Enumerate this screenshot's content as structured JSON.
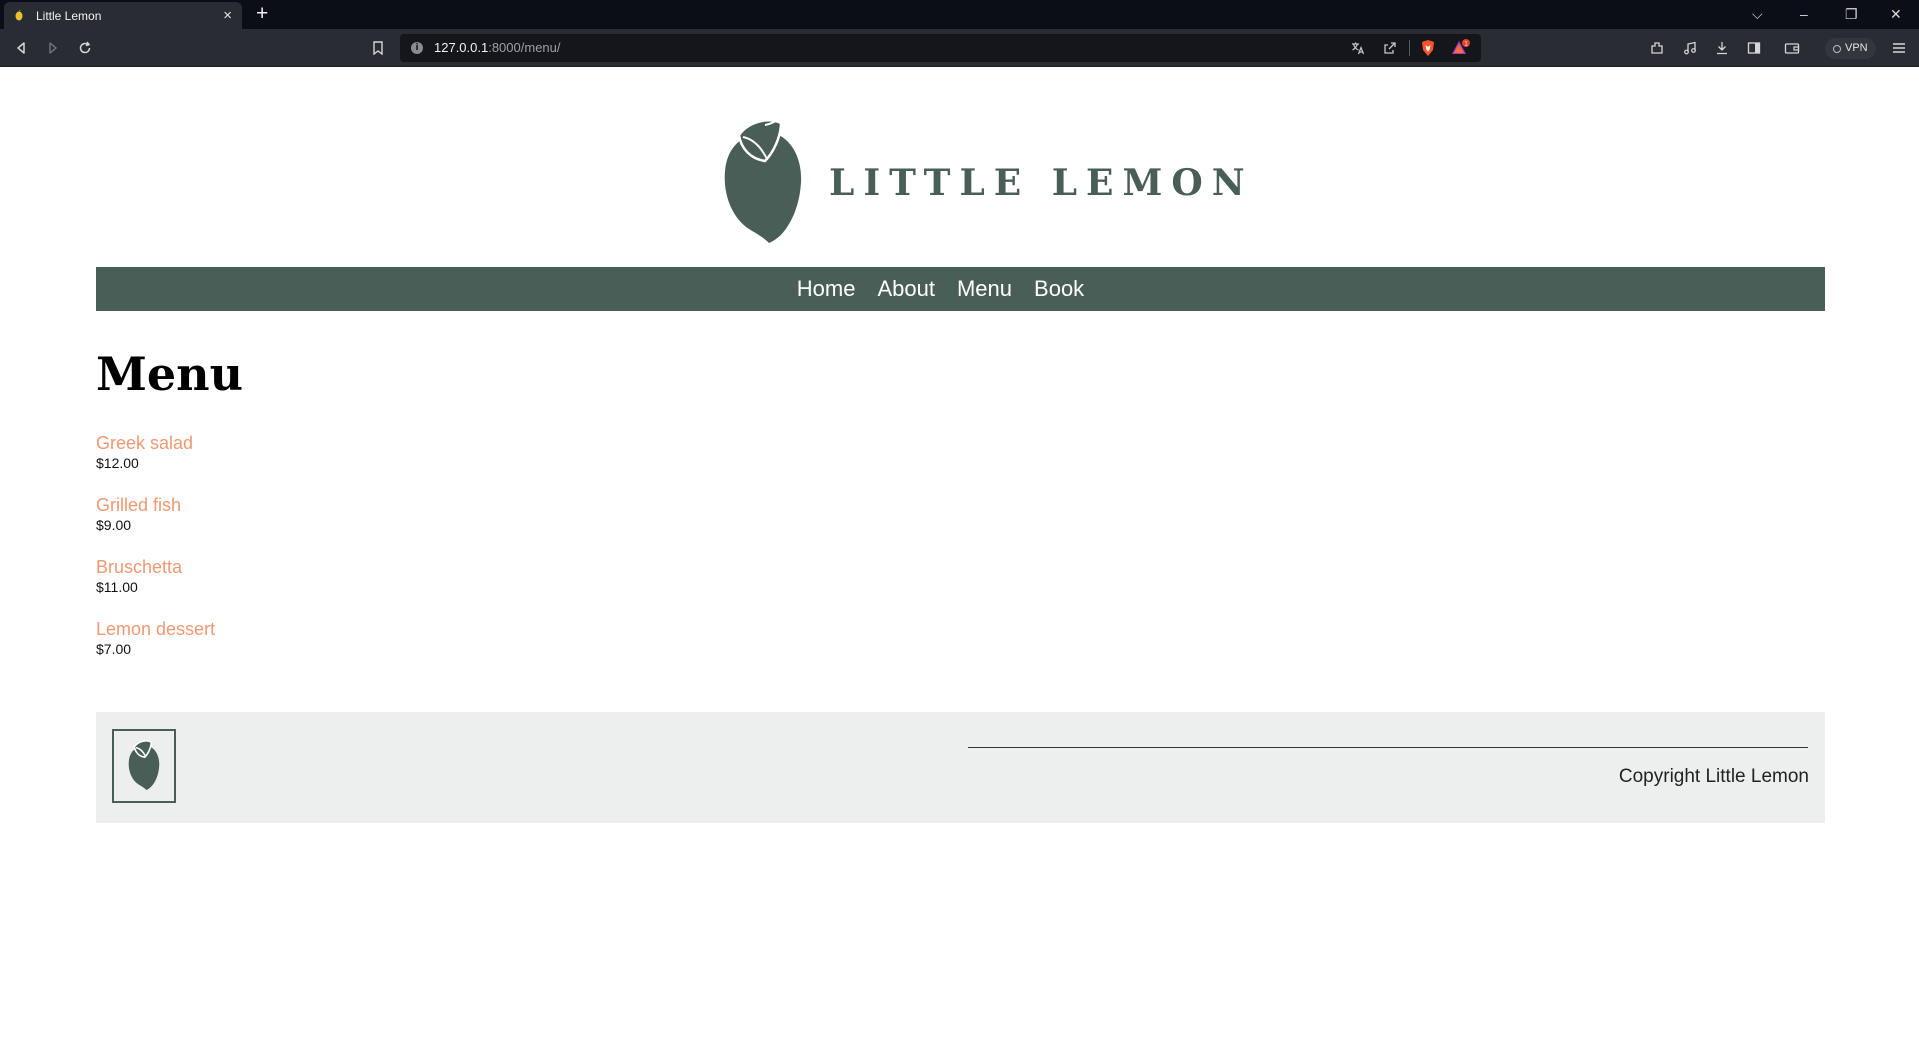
{
  "browser": {
    "tab_title": "Little Lemon",
    "tab_close": "×",
    "new_tab": "+",
    "url_host": "127.0.0.1",
    "url_rest": ":8000/menu/",
    "url_info": "i",
    "vpn_label": "VPN",
    "shield_badge_count": "1",
    "window_controls": {
      "tab_list": "⌵",
      "minimize": "–",
      "restore": "❐",
      "close": "✕"
    }
  },
  "site": {
    "brand": "LITTLE LEMON",
    "brand_color": "#495e57",
    "accent_color": "#ee9972",
    "nav": [
      "Home",
      "About",
      "Menu",
      "Book"
    ]
  },
  "main": {
    "title": "Menu",
    "items": [
      {
        "name": "Greek salad",
        "price": "$12.00"
      },
      {
        "name": "Grilled fish",
        "price": "$9.00"
      },
      {
        "name": "Bruschetta",
        "price": "$11.00"
      },
      {
        "name": "Lemon dessert",
        "price": "$7.00"
      }
    ]
  },
  "footer": {
    "copyright": "Copyright Little Lemon"
  }
}
